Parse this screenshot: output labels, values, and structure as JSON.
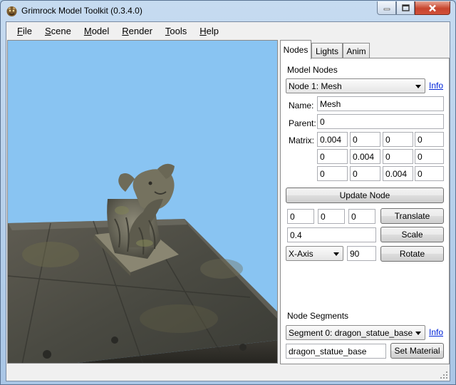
{
  "window": {
    "title": "Grimrock Model Toolkit (0.3.4.0)",
    "icon": "dragon-app-icon",
    "controls": [
      "minimize-icon",
      "maximize-icon",
      "close-icon"
    ]
  },
  "menu": {
    "items": [
      {
        "key": "F",
        "rest": "ile"
      },
      {
        "key": "S",
        "rest": "cene"
      },
      {
        "key": "M",
        "rest": "odel"
      },
      {
        "key": "R",
        "rest": "ender"
      },
      {
        "key": "T",
        "rest": "ools"
      },
      {
        "key": "H",
        "rest": "elp"
      }
    ]
  },
  "viewport": {
    "background": "#89c4f2",
    "content": "dragon statue on stone floor tile"
  },
  "tabs": [
    "Nodes",
    "Lights",
    "Anim"
  ],
  "nodes_tab": {
    "model_nodes_label": "Model Nodes",
    "node_select": "Node 1: Mesh",
    "info_link": "Info",
    "name_label": "Name:",
    "name_value": "Mesh",
    "parent_label": "Parent:",
    "parent_value": "0",
    "matrix_label": "Matrix:",
    "matrix": [
      [
        "0.004",
        "0",
        "0",
        "0"
      ],
      [
        "0",
        "0.004",
        "0",
        "0"
      ],
      [
        "0",
        "0",
        "0.004",
        "0"
      ]
    ],
    "update_node_button": "Update Node",
    "translate": {
      "x": "0",
      "y": "0",
      "z": "0",
      "button": "Translate"
    },
    "scale": {
      "value": "0.4",
      "button": "Scale"
    },
    "rotate": {
      "axis": "X-Axis",
      "angle": "90",
      "button": "Rotate"
    },
    "node_segments_label": "Node Segments",
    "segment_select": "Segment 0: dragon_statue_base",
    "segment_info_link": "Info",
    "material_value": "dragon_statue_base",
    "set_material_button": "Set Material"
  }
}
